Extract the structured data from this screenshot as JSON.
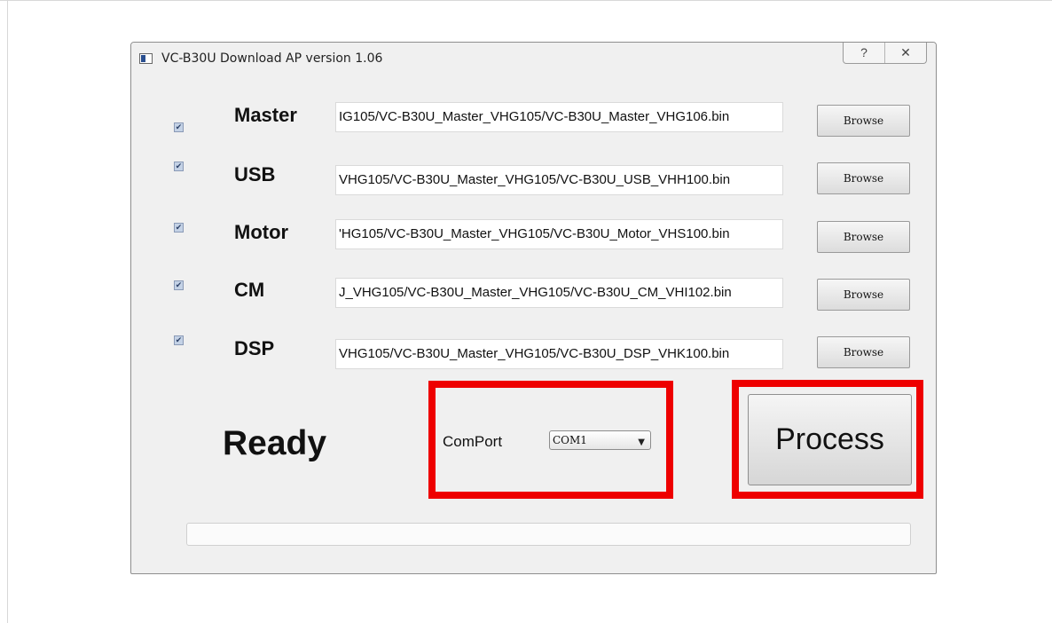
{
  "window": {
    "title": "VC-B30U Download AP version 1.06",
    "help_glyph": "?",
    "close_glyph": "✕"
  },
  "rows": [
    {
      "label": "Master",
      "checked": true,
      "path": "IG105/VC-B30U_Master_VHG105/VC-B30U_Master_VHG106.bin",
      "browse": "Browse"
    },
    {
      "label": "USB",
      "checked": true,
      "path": "VHG105/VC-B30U_Master_VHG105/VC-B30U_USB_VHH100.bin",
      "browse": "Browse"
    },
    {
      "label": "Motor",
      "checked": true,
      "path": "'HG105/VC-B30U_Master_VHG105/VC-B30U_Motor_VHS100.bin",
      "browse": "Browse"
    },
    {
      "label": "CM",
      "checked": true,
      "path": "J_VHG105/VC-B30U_Master_VHG105/VC-B30U_CM_VHI102.bin",
      "browse": "Browse"
    },
    {
      "label": "DSP",
      "checked": true,
      "path": "VHG105/VC-B30U_Master_VHG105/VC-B30U_DSP_VHK100.bin",
      "browse": "Browse"
    }
  ],
  "status": "Ready",
  "comport": {
    "label": "ComPort",
    "selected": "COM1"
  },
  "process_label": "Process",
  "progress": 0,
  "colors": {
    "highlight": "#ee0000",
    "progress_fill": "#3c9a3c"
  }
}
